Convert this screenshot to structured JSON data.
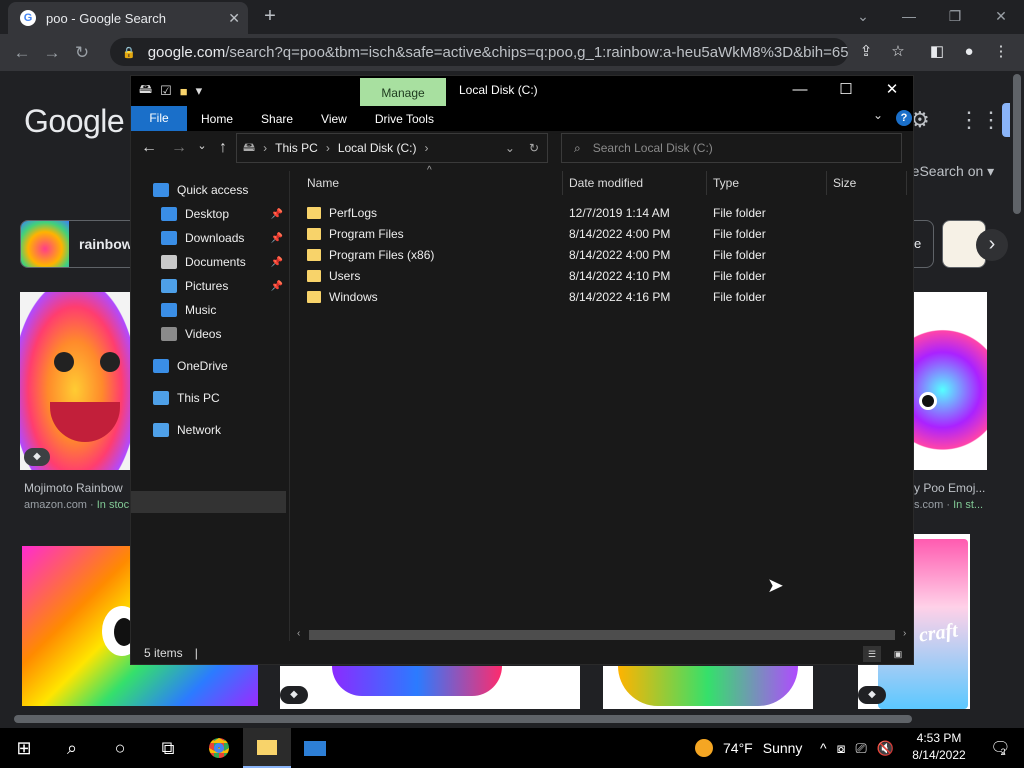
{
  "browser": {
    "tab_title": "poo - Google Search",
    "tab_favicon": "G",
    "close_tab": "✕",
    "new_tab": "+",
    "url_host": "google.com",
    "url_rest": "/search?q=poo&tbm=isch&safe=active&chips=q:poo,g_1:rainbow:a-heu5aWkM8%3D&bih=657&bi..."
  },
  "google": {
    "logo": "Google",
    "safesearch": "afeSearch on ▾",
    "chip_label": "rainbow",
    "chip_right_partial": "e",
    "caption1_title": "Mojimoto Rainbow",
    "caption1_source": "amazon.com · ",
    "caption1_stock": "In stoc",
    "caption2_title": "y Poo Emoj...",
    "caption2_source": "s.com · ",
    "caption2_stock": "In st...",
    "image6_text": "ush craft",
    "tag_icon": "tag-icon"
  },
  "explorer": {
    "manage_tab": "Manage",
    "window_title": "Local Disk (C:)",
    "ribbon": [
      "Home",
      "Share",
      "View",
      "Drive Tools"
    ],
    "file_tab": "File",
    "help": "?",
    "breadcrumb": [
      "This PC",
      "Local Disk (C:)"
    ],
    "search_placeholder": "Search Local Disk (C:)",
    "nav": [
      {
        "label": "Quick access",
        "icon": "star-icon",
        "color": "#3a8ee6",
        "indent": 0,
        "pin": false
      },
      {
        "label": "Desktop",
        "icon": "desktop-icon",
        "color": "#3a8ee6",
        "indent": 1,
        "pin": true
      },
      {
        "label": "Downloads",
        "icon": "download-icon",
        "color": "#3a8ee6",
        "indent": 1,
        "pin": true
      },
      {
        "label": "Documents",
        "icon": "document-icon",
        "color": "#c8c8c8",
        "indent": 1,
        "pin": true
      },
      {
        "label": "Pictures",
        "icon": "pictures-icon",
        "color": "#4ea0e8",
        "indent": 1,
        "pin": true
      },
      {
        "label": "Music",
        "icon": "music-icon",
        "color": "#3a8ee6",
        "indent": 1,
        "pin": false
      },
      {
        "label": "Videos",
        "icon": "videos-icon",
        "color": "#8a8a8a",
        "indent": 1,
        "pin": false
      },
      {
        "label": "OneDrive",
        "icon": "onedrive-icon",
        "color": "#3a8ee6",
        "indent": 0,
        "pin": false
      },
      {
        "label": "This PC",
        "icon": "this-pc-icon",
        "color": "#4ea0e8",
        "indent": 0,
        "pin": false
      },
      {
        "label": "Network",
        "icon": "network-icon",
        "color": "#4ea0e8",
        "indent": 0,
        "pin": false
      }
    ],
    "columns": [
      "Name",
      "Date modified",
      "Type",
      "Size"
    ],
    "rows": [
      {
        "name": "PerfLogs",
        "date": "12/7/2019 1:14 AM",
        "type": "File folder"
      },
      {
        "name": "Program Files",
        "date": "8/14/2022 4:00 PM",
        "type": "File folder"
      },
      {
        "name": "Program Files (x86)",
        "date": "8/14/2022 4:00 PM",
        "type": "File folder"
      },
      {
        "name": "Users",
        "date": "8/14/2022 4:10 PM",
        "type": "File folder"
      },
      {
        "name": "Windows",
        "date": "8/14/2022 4:16 PM",
        "type": "File folder"
      }
    ],
    "status": "5 items"
  },
  "taskbar": {
    "temperature": "74°F",
    "weather": "Sunny",
    "time": "4:53 PM",
    "date": "8/14/2022",
    "notifications": "2"
  },
  "colors": {
    "accent": "#1a6fc9",
    "manage_tab": "#a8e0a0",
    "folder": "#f8d36a"
  }
}
